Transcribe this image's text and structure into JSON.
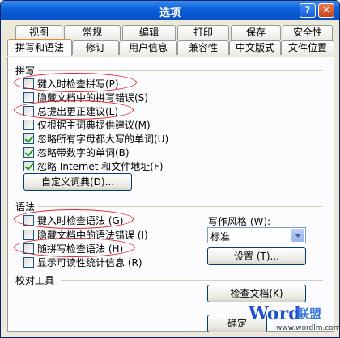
{
  "window": {
    "title": "选项",
    "help_icon": "help-icon",
    "close_icon": "close-icon"
  },
  "tabs": {
    "row1": [
      "视图",
      "常规",
      "编辑",
      "打印",
      "保存",
      "安全性"
    ],
    "row2": [
      "拼写和语法",
      "修订",
      "用户信息",
      "兼容性",
      "中文版式",
      "文件位置"
    ],
    "active": "拼写和语法"
  },
  "spelling": {
    "title": "拼写",
    "options": [
      {
        "label": "键入时检查拼写(P)",
        "checked": false
      },
      {
        "label": "隐藏文档中的拼写错误(S)",
        "checked": false
      },
      {
        "label": "总提出更正建议(L)",
        "checked": false
      },
      {
        "label": "仅根据主词典提供建议(M)",
        "checked": false
      },
      {
        "label": "忽略所有字母都大写的单词(U)",
        "checked": true
      },
      {
        "label": "忽略带数字的单词(B)",
        "checked": true
      },
      {
        "label": "忽略 Internet 和文件地址(F)",
        "checked": true
      }
    ],
    "custom_dict_button": "自定义词典(D)..."
  },
  "grammar": {
    "title": "语法",
    "options": [
      {
        "label": "键入时检查语法 (G)",
        "checked": false
      },
      {
        "label": "隐藏文档中的语法错误 (I)",
        "checked": false
      },
      {
        "label": "随拼写检查语法 (H)",
        "checked": false
      },
      {
        "label": "显示可读性统计信息 (R)",
        "checked": false
      }
    ],
    "style_label": "写作风格 (W):",
    "style_value": "标准",
    "settings_button": "设置 (T)..."
  },
  "proofing": {
    "title": "校对工具",
    "check_doc_button": "检查文档(K)"
  },
  "footer": {
    "ok_button": "确定"
  },
  "watermark": {
    "brand": "Word",
    "brand_cn": "联盟",
    "url": "www.wordlm.com"
  },
  "colors": {
    "title_bar": "#0a5fd8",
    "annotation_ring": "#e0242c",
    "active_tab_accent": "#e68b2c"
  }
}
